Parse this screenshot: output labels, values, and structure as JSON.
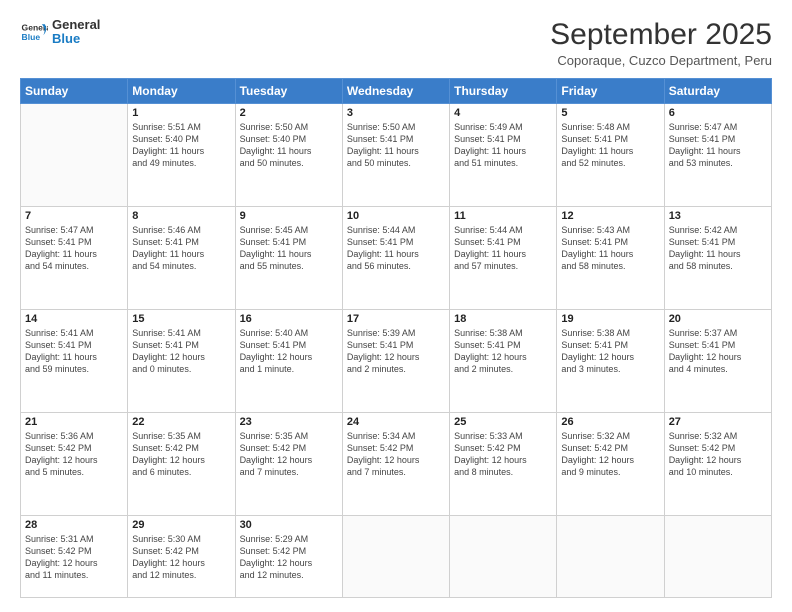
{
  "header": {
    "logo_general": "General",
    "logo_blue": "Blue",
    "title": "September 2025",
    "subtitle": "Coporaque, Cuzco Department, Peru"
  },
  "columns": [
    "Sunday",
    "Monday",
    "Tuesday",
    "Wednesday",
    "Thursday",
    "Friday",
    "Saturday"
  ],
  "weeks": [
    [
      {
        "day": "",
        "info": ""
      },
      {
        "day": "1",
        "info": "Sunrise: 5:51 AM\nSunset: 5:40 PM\nDaylight: 11 hours\nand 49 minutes."
      },
      {
        "day": "2",
        "info": "Sunrise: 5:50 AM\nSunset: 5:40 PM\nDaylight: 11 hours\nand 50 minutes."
      },
      {
        "day": "3",
        "info": "Sunrise: 5:50 AM\nSunset: 5:41 PM\nDaylight: 11 hours\nand 50 minutes."
      },
      {
        "day": "4",
        "info": "Sunrise: 5:49 AM\nSunset: 5:41 PM\nDaylight: 11 hours\nand 51 minutes."
      },
      {
        "day": "5",
        "info": "Sunrise: 5:48 AM\nSunset: 5:41 PM\nDaylight: 11 hours\nand 52 minutes."
      },
      {
        "day": "6",
        "info": "Sunrise: 5:47 AM\nSunset: 5:41 PM\nDaylight: 11 hours\nand 53 minutes."
      }
    ],
    [
      {
        "day": "7",
        "info": "Sunrise: 5:47 AM\nSunset: 5:41 PM\nDaylight: 11 hours\nand 54 minutes."
      },
      {
        "day": "8",
        "info": "Sunrise: 5:46 AM\nSunset: 5:41 PM\nDaylight: 11 hours\nand 54 minutes."
      },
      {
        "day": "9",
        "info": "Sunrise: 5:45 AM\nSunset: 5:41 PM\nDaylight: 11 hours\nand 55 minutes."
      },
      {
        "day": "10",
        "info": "Sunrise: 5:44 AM\nSunset: 5:41 PM\nDaylight: 11 hours\nand 56 minutes."
      },
      {
        "day": "11",
        "info": "Sunrise: 5:44 AM\nSunset: 5:41 PM\nDaylight: 11 hours\nand 57 minutes."
      },
      {
        "day": "12",
        "info": "Sunrise: 5:43 AM\nSunset: 5:41 PM\nDaylight: 11 hours\nand 58 minutes."
      },
      {
        "day": "13",
        "info": "Sunrise: 5:42 AM\nSunset: 5:41 PM\nDaylight: 11 hours\nand 58 minutes."
      }
    ],
    [
      {
        "day": "14",
        "info": "Sunrise: 5:41 AM\nSunset: 5:41 PM\nDaylight: 11 hours\nand 59 minutes."
      },
      {
        "day": "15",
        "info": "Sunrise: 5:41 AM\nSunset: 5:41 PM\nDaylight: 12 hours\nand 0 minutes."
      },
      {
        "day": "16",
        "info": "Sunrise: 5:40 AM\nSunset: 5:41 PM\nDaylight: 12 hours\nand 1 minute."
      },
      {
        "day": "17",
        "info": "Sunrise: 5:39 AM\nSunset: 5:41 PM\nDaylight: 12 hours\nand 2 minutes."
      },
      {
        "day": "18",
        "info": "Sunrise: 5:38 AM\nSunset: 5:41 PM\nDaylight: 12 hours\nand 2 minutes."
      },
      {
        "day": "19",
        "info": "Sunrise: 5:38 AM\nSunset: 5:41 PM\nDaylight: 12 hours\nand 3 minutes."
      },
      {
        "day": "20",
        "info": "Sunrise: 5:37 AM\nSunset: 5:41 PM\nDaylight: 12 hours\nand 4 minutes."
      }
    ],
    [
      {
        "day": "21",
        "info": "Sunrise: 5:36 AM\nSunset: 5:42 PM\nDaylight: 12 hours\nand 5 minutes."
      },
      {
        "day": "22",
        "info": "Sunrise: 5:35 AM\nSunset: 5:42 PM\nDaylight: 12 hours\nand 6 minutes."
      },
      {
        "day": "23",
        "info": "Sunrise: 5:35 AM\nSunset: 5:42 PM\nDaylight: 12 hours\nand 7 minutes."
      },
      {
        "day": "24",
        "info": "Sunrise: 5:34 AM\nSunset: 5:42 PM\nDaylight: 12 hours\nand 7 minutes."
      },
      {
        "day": "25",
        "info": "Sunrise: 5:33 AM\nSunset: 5:42 PM\nDaylight: 12 hours\nand 8 minutes."
      },
      {
        "day": "26",
        "info": "Sunrise: 5:32 AM\nSunset: 5:42 PM\nDaylight: 12 hours\nand 9 minutes."
      },
      {
        "day": "27",
        "info": "Sunrise: 5:32 AM\nSunset: 5:42 PM\nDaylight: 12 hours\nand 10 minutes."
      }
    ],
    [
      {
        "day": "28",
        "info": "Sunrise: 5:31 AM\nSunset: 5:42 PM\nDaylight: 12 hours\nand 11 minutes."
      },
      {
        "day": "29",
        "info": "Sunrise: 5:30 AM\nSunset: 5:42 PM\nDaylight: 12 hours\nand 12 minutes."
      },
      {
        "day": "30",
        "info": "Sunrise: 5:29 AM\nSunset: 5:42 PM\nDaylight: 12 hours\nand 12 minutes."
      },
      {
        "day": "",
        "info": ""
      },
      {
        "day": "",
        "info": ""
      },
      {
        "day": "",
        "info": ""
      },
      {
        "day": "",
        "info": ""
      }
    ]
  ]
}
